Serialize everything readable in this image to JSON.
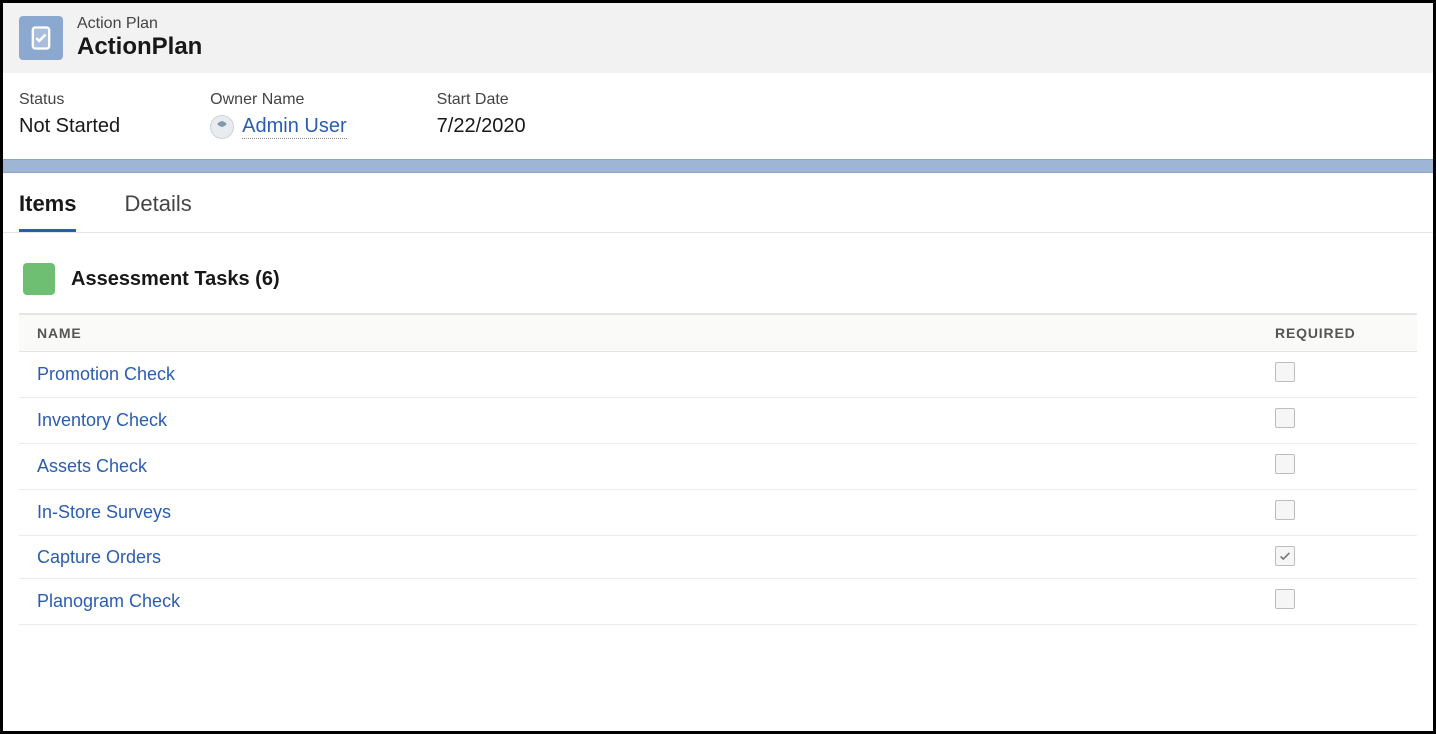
{
  "header": {
    "eyebrow": "Action Plan",
    "title": "ActionPlan"
  },
  "fields": {
    "status_label": "Status",
    "status_value": "Not Started",
    "owner_label": "Owner Name",
    "owner_value": "Admin User",
    "startdate_label": "Start Date",
    "startdate_value": "7/22/2020"
  },
  "tabs": {
    "items_label": "Items",
    "details_label": "Details",
    "active": "items"
  },
  "section": {
    "title": "Assessment Tasks (6)"
  },
  "columns": {
    "name": "NAME",
    "required": "REQUIRED"
  },
  "rows": [
    {
      "name": "Promotion Check",
      "required": false
    },
    {
      "name": "Inventory Check",
      "required": false
    },
    {
      "name": "Assets Check",
      "required": false
    },
    {
      "name": "In-Store Surveys",
      "required": false
    },
    {
      "name": "Capture Orders",
      "required": true
    },
    {
      "name": "Planogram Check",
      "required": false
    }
  ]
}
